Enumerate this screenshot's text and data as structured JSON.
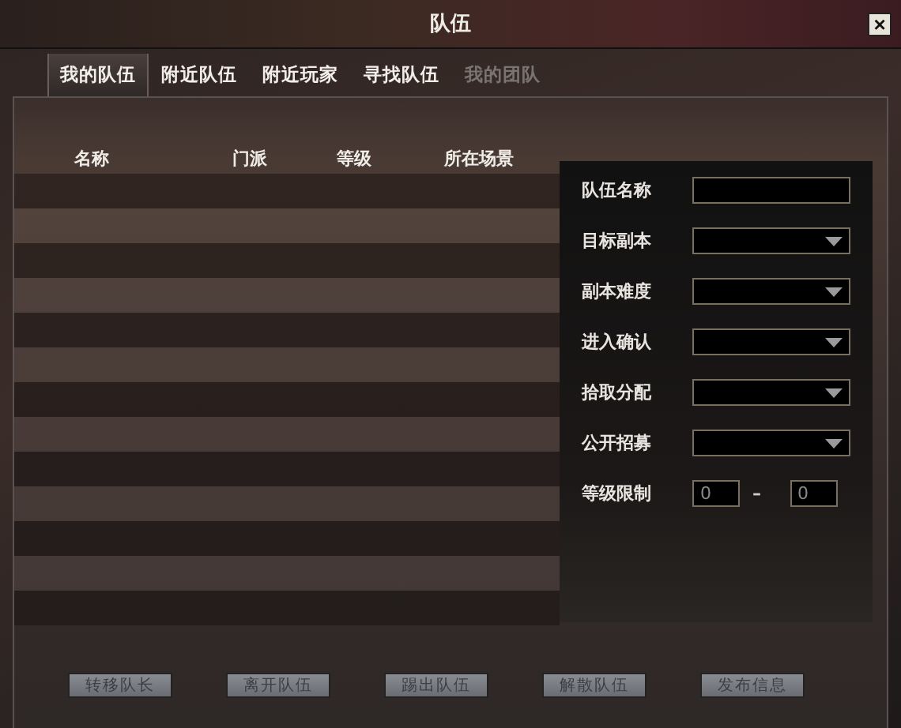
{
  "window": {
    "title": "队伍",
    "close": "×"
  },
  "tabs": [
    {
      "label": "我的队伍",
      "selected": true,
      "disabled": false
    },
    {
      "label": "附近队伍",
      "selected": false,
      "disabled": false
    },
    {
      "label": "附近玩家",
      "selected": false,
      "disabled": false
    },
    {
      "label": "寻找队伍",
      "selected": false,
      "disabled": false
    },
    {
      "label": "我的团队",
      "selected": false,
      "disabled": true
    }
  ],
  "table": {
    "columns": [
      "名称",
      "门派",
      "等级",
      "所在场景"
    ]
  },
  "settings": [
    {
      "kind": "text",
      "label": "队伍名称"
    },
    {
      "kind": "dropdown",
      "label": "目标副本"
    },
    {
      "kind": "dropdown",
      "label": "副本难度"
    },
    {
      "kind": "dropdown",
      "label": "进入确认"
    },
    {
      "kind": "dropdown",
      "label": "拾取分配"
    },
    {
      "kind": "dropdown",
      "label": "公开招募"
    },
    {
      "kind": "range",
      "label": "等级限制",
      "from": "0",
      "separator": "–",
      "to": "0"
    }
  ],
  "buttons": [
    {
      "label": "转移队长",
      "disabled": true
    },
    {
      "label": "离开队伍",
      "disabled": true
    },
    {
      "label": "踢出队伍",
      "disabled": true
    },
    {
      "label": "解散队伍",
      "disabled": true
    },
    {
      "label": "发布信息",
      "disabled": true
    }
  ]
}
